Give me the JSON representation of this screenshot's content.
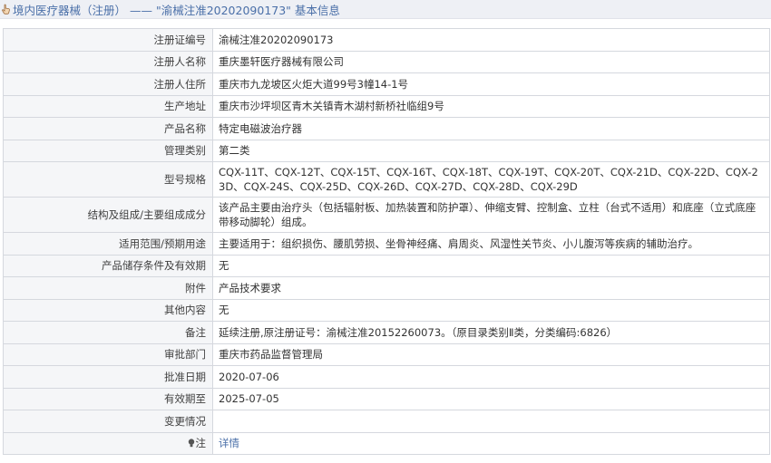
{
  "header": {
    "title": "境内医疗器械（注册） —— \"渝械注准20202090173\" 基本信息"
  },
  "rows": [
    {
      "label": "注册证编号",
      "value": "渝械注准20202090173"
    },
    {
      "label": "注册人名称",
      "value": "重庆墨轩医疗器械有限公司"
    },
    {
      "label": "注册人住所",
      "value": "重庆市九龙坡区火炬大道99号3幢14-1号"
    },
    {
      "label": "生产地址",
      "value": "重庆市沙坪坝区青木关镇青木湖村新桥社临组9号"
    },
    {
      "label": "产品名称",
      "value": "特定电磁波治疗器"
    },
    {
      "label": "管理类别",
      "value": "第二类"
    },
    {
      "label": "型号规格",
      "value": "CQX-11T、CQX-12T、CQX-15T、CQX-16T、CQX-18T、CQX-19T、CQX-20T、CQX-21D、CQX-22D、CQX-23D、CQX-24S、CQX-25D、CQX-26D、CQX-27D、CQX-28D、CQX-29D"
    },
    {
      "label": "结构及组成/主要组成成分",
      "value": "该产品主要由治疗头（包括辐射板、加热装置和防护罩）、伸缩支臂、控制盒、立柱（台式不适用）和底座（立式底座带移动脚轮）组成。"
    },
    {
      "label": "适用范围/预期用途",
      "value": "主要适用于：组织损伤、腰肌劳损、坐骨神经痛、肩周炎、风湿性关节炎、小儿腹泻等疾病的辅助治疗。"
    },
    {
      "label": "产品储存条件及有效期",
      "value": "无"
    },
    {
      "label": "附件",
      "value": "产品技术要求"
    },
    {
      "label": "其他内容",
      "value": "无"
    },
    {
      "label": "备注",
      "value": "延续注册,原注册证号：渝械注准20152260073。（原目录类别Ⅱ类，分类编码:6826）"
    },
    {
      "label": "审批部门",
      "value": "重庆市药品监督管理局"
    },
    {
      "label": "批准日期",
      "value": "2020-07-06"
    },
    {
      "label": "有效期至",
      "value": "2025-07-05"
    },
    {
      "label": "变更情况",
      "value": ""
    }
  ],
  "note_row": {
    "label": "注",
    "link_text": "详情"
  }
}
